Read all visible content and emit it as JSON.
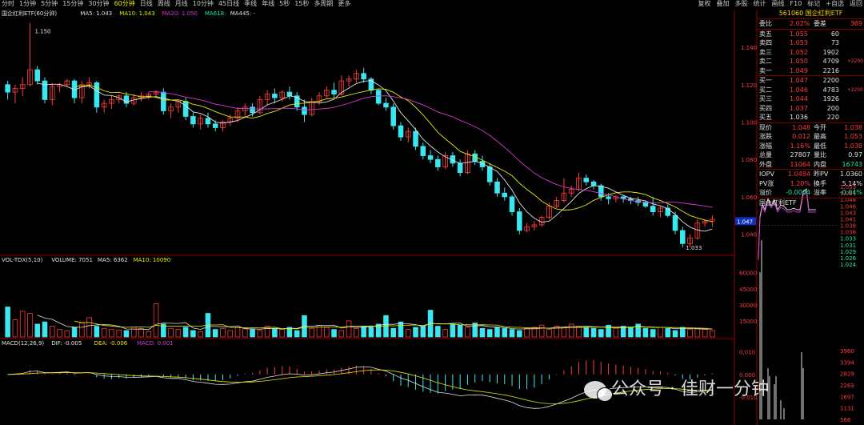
{
  "toolbar": {
    "periods": [
      "分时",
      "1分钟",
      "5分钟",
      "15分钟",
      "30分钟",
      "60分钟",
      "日线",
      "周线",
      "月线",
      "10分钟",
      "45日线",
      "季线",
      "年线",
      "5秒",
      "15秒",
      "多周期",
      "更多"
    ],
    "active_period": "60分钟",
    "right_actions": [
      "复权",
      "叠加",
      "多股",
      "统计",
      "画线",
      "F10",
      "标记",
      "+自选",
      "返回"
    ]
  },
  "main_chart": {
    "legend": {
      "name": "国企红利ETF(60分钟)",
      "ma5": "MA5: 1.043",
      "ma10": "MA10: 1.043",
      "ma20": "MA20: 1.050",
      "ma618": "MA618:",
      "ma445": "MA445: -"
    },
    "high_label": "1.150",
    "low_label": "1.033",
    "current_price_tag": "1.047"
  },
  "volume_chart": {
    "legend": {
      "name": "VOL-TDX(5,10)",
      "volume": "VOLUME: 7051",
      "ma5": "MA5: 6362",
      "ma10": "MA10: 10090"
    }
  },
  "macd_chart": {
    "legend": {
      "name": "MACD(12,26,9)",
      "dif": "DIF: -0.005",
      "dea": "DEA: -0.006",
      "macd": "MACD: 0.001"
    }
  },
  "chart_data": [
    {
      "type": "candlestick",
      "title": "国企红利ETF(60分钟)",
      "ylim": [
        1.03,
        1.155
      ],
      "yticks": [
        1.04,
        1.06,
        1.08,
        1.1,
        1.12,
        1.14
      ],
      "candles": [
        [
          1.12,
          1.122,
          1.112,
          1.116
        ],
        [
          1.116,
          1.12,
          1.11,
          1.118
        ],
        [
          1.118,
          1.124,
          1.114,
          1.12
        ],
        [
          1.12,
          1.153,
          1.119,
          1.128
        ],
        [
          1.128,
          1.13,
          1.12,
          1.122
        ],
        [
          1.122,
          1.124,
          1.11,
          1.112
        ],
        [
          1.112,
          1.121,
          1.109,
          1.119
        ],
        [
          1.119,
          1.121,
          1.116,
          1.12
        ],
        [
          1.12,
          1.123,
          1.119,
          1.122
        ],
        [
          1.122,
          1.123,
          1.11,
          1.113
        ],
        [
          1.113,
          1.122,
          1.11,
          1.12
        ],
        [
          1.12,
          1.124,
          1.118,
          1.121
        ],
        [
          1.121,
          1.122,
          1.105,
          1.108
        ],
        [
          1.108,
          1.112,
          1.105,
          1.11
        ],
        [
          1.11,
          1.114,
          1.107,
          1.112
        ],
        [
          1.112,
          1.115,
          1.11,
          1.114
        ],
        [
          1.114,
          1.116,
          1.108,
          1.11
        ],
        [
          1.11,
          1.115,
          1.109,
          1.113
        ],
        [
          1.113,
          1.116,
          1.111,
          1.114
        ],
        [
          1.114,
          1.116,
          1.112,
          1.115
        ],
        [
          1.115,
          1.117,
          1.113,
          1.116
        ],
        [
          1.116,
          1.118,
          1.104,
          1.106
        ],
        [
          1.106,
          1.11,
          1.102,
          1.108
        ],
        [
          1.108,
          1.112,
          1.105,
          1.111
        ],
        [
          1.111,
          1.113,
          1.101,
          1.103
        ],
        [
          1.103,
          1.105,
          1.097,
          1.099
        ],
        [
          1.099,
          1.104,
          1.096,
          1.102
        ],
        [
          1.102,
          1.105,
          1.097,
          1.099
        ],
        [
          1.099,
          1.101,
          1.095,
          1.097
        ],
        [
          1.097,
          1.101,
          1.095,
          1.1
        ],
        [
          1.1,
          1.104,
          1.098,
          1.102
        ],
        [
          1.102,
          1.108,
          1.1,
          1.106
        ],
        [
          1.106,
          1.11,
          1.103,
          1.108
        ],
        [
          1.108,
          1.11,
          1.103,
          1.105
        ],
        [
          1.105,
          1.114,
          1.104,
          1.112
        ],
        [
          1.112,
          1.117,
          1.109,
          1.115
        ],
        [
          1.115,
          1.118,
          1.11,
          1.113
        ],
        [
          1.113,
          1.117,
          1.111,
          1.116
        ],
        [
          1.116,
          1.119,
          1.112,
          1.114
        ],
        [
          1.114,
          1.116,
          1.106,
          1.108
        ],
        [
          1.108,
          1.112,
          1.1,
          1.104
        ],
        [
          1.104,
          1.113,
          1.103,
          1.111
        ],
        [
          1.111,
          1.116,
          1.109,
          1.114
        ],
        [
          1.114,
          1.119,
          1.113,
          1.117
        ],
        [
          1.117,
          1.121,
          1.113,
          1.115
        ],
        [
          1.115,
          1.125,
          1.114,
          1.122
        ],
        [
          1.122,
          1.125,
          1.119,
          1.123
        ],
        [
          1.123,
          1.128,
          1.121,
          1.126
        ],
        [
          1.126,
          1.129,
          1.121,
          1.123
        ],
        [
          1.123,
          1.124,
          1.115,
          1.117
        ],
        [
          1.117,
          1.118,
          1.109,
          1.11
        ],
        [
          1.11,
          1.113,
          1.106,
          1.108
        ],
        [
          1.108,
          1.11,
          1.096,
          1.098
        ],
        [
          1.098,
          1.1,
          1.09,
          1.092
        ],
        [
          1.092,
          1.097,
          1.089,
          1.095
        ],
        [
          1.095,
          1.097,
          1.085,
          1.087
        ],
        [
          1.087,
          1.089,
          1.08,
          1.082
        ],
        [
          1.082,
          1.085,
          1.078,
          1.08
        ],
        [
          1.08,
          1.082,
          1.074,
          1.076
        ],
        [
          1.076,
          1.084,
          1.075,
          1.082
        ],
        [
          1.082,
          1.084,
          1.076,
          1.078
        ],
        [
          1.078,
          1.08,
          1.071,
          1.073
        ],
        [
          1.073,
          1.085,
          1.072,
          1.083
        ],
        [
          1.083,
          1.085,
          1.077,
          1.079
        ],
        [
          1.079,
          1.082,
          1.074,
          1.076
        ],
        [
          1.076,
          1.078,
          1.066,
          1.068
        ],
        [
          1.068,
          1.07,
          1.06,
          1.062
        ],
        [
          1.062,
          1.065,
          1.058,
          1.06
        ],
        [
          1.06,
          1.061,
          1.05,
          1.052
        ],
        [
          1.052,
          1.054,
          1.04,
          1.042
        ],
        [
          1.042,
          1.046,
          1.041,
          1.044
        ],
        [
          1.044,
          1.047,
          1.042,
          1.045
        ],
        [
          1.045,
          1.05,
          1.044,
          1.049
        ],
        [
          1.049,
          1.057,
          1.048,
          1.055
        ],
        [
          1.055,
          1.06,
          1.054,
          1.058
        ],
        [
          1.058,
          1.07,
          1.057,
          1.062
        ],
        [
          1.062,
          1.066,
          1.06,
          1.064
        ],
        [
          1.064,
          1.073,
          1.063,
          1.07
        ],
        [
          1.07,
          1.072,
          1.066,
          1.068
        ],
        [
          1.068,
          1.069,
          1.064,
          1.066
        ],
        [
          1.066,
          1.067,
          1.058,
          1.06
        ],
        [
          1.06,
          1.062,
          1.056,
          1.059
        ],
        [
          1.059,
          1.061,
          1.057,
          1.06
        ],
        [
          1.06,
          1.061,
          1.057,
          1.059
        ],
        [
          1.059,
          1.06,
          1.056,
          1.058
        ],
        [
          1.058,
          1.06,
          1.055,
          1.057
        ],
        [
          1.057,
          1.058,
          1.054,
          1.055
        ],
        [
          1.055,
          1.06,
          1.05,
          1.052
        ],
        [
          1.052,
          1.055,
          1.049,
          1.054
        ],
        [
          1.054,
          1.056,
          1.049,
          1.05
        ],
        [
          1.05,
          1.052,
          1.04,
          1.042
        ],
        [
          1.042,
          1.044,
          1.033,
          1.035
        ],
        [
          1.035,
          1.04,
          1.033,
          1.038
        ],
        [
          1.038,
          1.048,
          1.037,
          1.046
        ],
        [
          1.046,
          1.048,
          1.044,
          1.047
        ],
        [
          1.047,
          1.05,
          1.044,
          1.048
        ]
      ],
      "ma_series": [
        {
          "name": "MA5",
          "color": "#e0e0e0",
          "period": 5
        },
        {
          "name": "MA10",
          "color": "#e9e900",
          "period": 10
        },
        {
          "name": "MA20",
          "color": "#d23ad2",
          "period": 20
        }
      ]
    },
    {
      "type": "bar",
      "title": "VOL-TDX(5,10)",
      "ylim": [
        0,
        65000
      ],
      "yticks": [
        15000,
        30000,
        45000,
        60000
      ],
      "values": [
        28000,
        16000,
        24000,
        22000,
        12000,
        14000,
        10000,
        7000,
        6000,
        9000,
        13000,
        18000,
        10000,
        8000,
        7000,
        6500,
        6000,
        9000,
        8000,
        5000,
        31000,
        12000,
        8000,
        7000,
        9000,
        6000,
        5000,
        22000,
        7000,
        8000,
        6000,
        9000,
        8000,
        7000,
        6000,
        10000,
        8000,
        7000,
        9000,
        6000,
        20000,
        8000,
        11000,
        9000,
        7000,
        6000,
        15000,
        8000,
        10000,
        9000,
        12000,
        20000,
        8000,
        14000,
        7000,
        9000,
        10000,
        25000,
        10000,
        7000,
        12000,
        11000,
        9000,
        13000,
        8000,
        7000,
        9000,
        8000,
        7000,
        6000,
        8000,
        9000,
        11000,
        7000,
        10000,
        9000,
        12000,
        10000,
        9000,
        8000,
        7000,
        11000,
        8000,
        10000,
        9000,
        12000,
        8000,
        7000,
        9000,
        8000,
        6000,
        9000,
        7000,
        8000,
        7051,
        6000
      ],
      "ma5_color": "#e0e0e0",
      "ma10_color": "#e9e900"
    },
    {
      "type": "line",
      "title": "MACD(12,26,9)",
      "ylim": [
        -0.02,
        0.012
      ],
      "yticks": [
        -0.01,
        0.0,
        0.01
      ],
      "series": [
        {
          "name": "DIF",
          "color": "#e0e0e0"
        },
        {
          "name": "DEA",
          "color": "#e9e900"
        },
        {
          "name": "MACD",
          "color": "#d23ad2"
        }
      ]
    }
  ],
  "quote_panel": {
    "header": "561060 国企红利ETF",
    "wei": {
      "label": "委比",
      "value": "2.02%",
      "label2": "委差",
      "value2": "369"
    },
    "asks": [
      {
        "label": "卖五",
        "price": "1.055",
        "vol": "60",
        "extra": ""
      },
      {
        "label": "卖四",
        "price": "1.053",
        "vol": "73",
        "extra": ""
      },
      {
        "label": "卖三",
        "price": "1.052",
        "vol": "1902",
        "extra": ""
      },
      {
        "label": "卖二",
        "price": "1.050",
        "vol": "4709",
        "extra": "+2200"
      },
      {
        "label": "卖一",
        "price": "1.049",
        "vol": "2216",
        "extra": ""
      }
    ],
    "bids": [
      {
        "label": "买一",
        "price": "1.047",
        "vol": "2200",
        "extra": ""
      },
      {
        "label": "买二",
        "price": "1.046",
        "vol": "4783",
        "extra": "+2200"
      },
      {
        "label": "买三",
        "price": "1.044",
        "vol": "1926",
        "extra": ""
      },
      {
        "label": "买四",
        "price": "1.037",
        "vol": "200",
        "extra": ""
      },
      {
        "label": "买五",
        "price": "1.036",
        "vol": "220",
        "extra": ""
      }
    ],
    "stats": [
      {
        "l1": "现价",
        "v1": "1.048",
        "l2": "今开",
        "v2": "1.038"
      },
      {
        "l1": "涨跌",
        "v1": "0.012",
        "l2": "最高",
        "v2": "1.053"
      },
      {
        "l1": "涨幅",
        "v1": "1.16%",
        "l2": "最低",
        "v2": "1.038"
      },
      {
        "l1": "总量",
        "v1": "27807",
        "l2": "量比",
        "v2": "0.97"
      },
      {
        "l1": "外盘",
        "v1": "11064",
        "l2": "内盘",
        "v2": "16743"
      }
    ],
    "iopv": [
      {
        "l1": "IOPV",
        "v1": "1.0484",
        "l2": "昨PV",
        "v2": "1.0360"
      },
      {
        "l1": "PV涨",
        "v1": "1.20%",
        "l2": "换手",
        "v2": "5.14%"
      },
      {
        "l1": "溢价",
        "v1": "-0.0004",
        "l2": "溢率",
        "v2": "-0.04%"
      }
    ],
    "mini_title": "国企红利ETF",
    "mini_prices": [
      "1.053",
      "1.051",
      "1.048",
      "1.046",
      "1.043",
      "1.041",
      "1.038",
      "1.036",
      "1.033",
      "1.031",
      "1.029",
      "1.026",
      "1.024"
    ],
    "mini_vol": [
      "3960",
      "3394",
      "2829",
      "2263",
      "1697",
      "1131",
      "566"
    ]
  },
  "watermark": "公众号 · 佳财一分钟"
}
